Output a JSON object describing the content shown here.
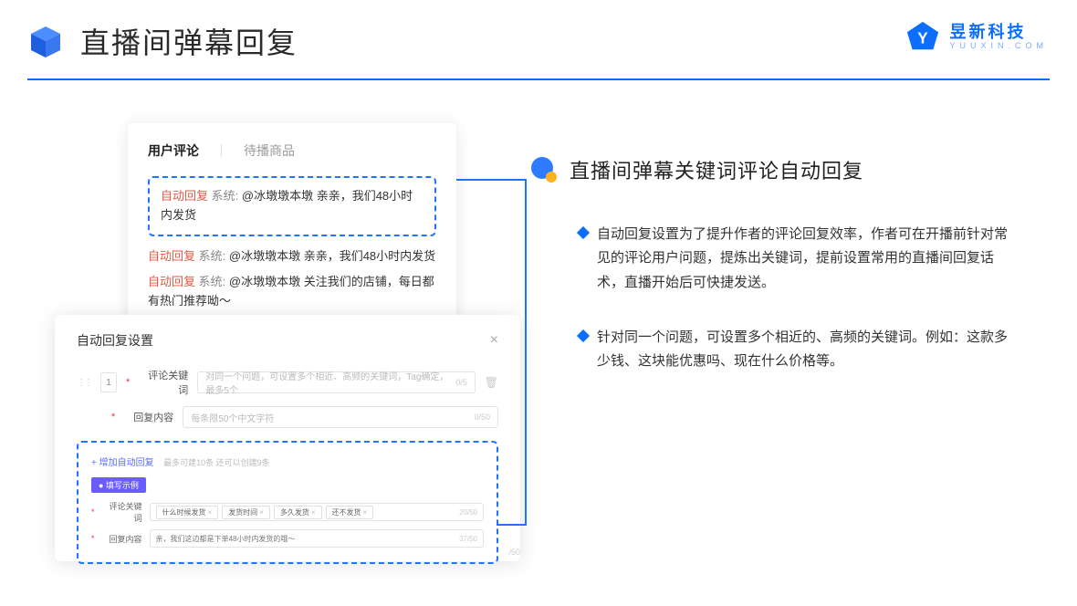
{
  "header": {
    "title": "直播间弹幕回复"
  },
  "brand": {
    "cn": "昱新科技",
    "en": "YUUXIN.COM"
  },
  "comments_card": {
    "tabs": {
      "active": "用户评论",
      "inactive": "待播商品"
    },
    "highlighted": {
      "tag": "自动回复",
      "sys": "系统:",
      "msg": "@冰墩墩本墩 亲亲，我们48小时内发货"
    },
    "rows": [
      {
        "tag": "自动回复",
        "sys": "系统:",
        "msg": "@冰墩墩本墩 亲亲，我们48小时内发货"
      },
      {
        "tag": "自动回复",
        "sys": "系统:",
        "msg": "@冰墩墩本墩 关注我们的店铺，每日都有热门推荐呦～"
      }
    ]
  },
  "settings_card": {
    "title": "自动回复设置",
    "idx": "1",
    "kw": {
      "label": "评论关键词",
      "placeholder": "对同一个问题，可设置多个相近、高频的关键词，Tag确定，最多5个",
      "count": "0/5"
    },
    "reply": {
      "label": "回复内容",
      "placeholder": "每条限50个中文字符",
      "count": "0/50"
    },
    "add": {
      "link": "+ 增加自动回复",
      "note": "最多可建10条 还可以创建9条"
    },
    "example": {
      "badge": "● 填写示例",
      "kw_label": "评论关键词",
      "tags": [
        "什么时候发货",
        "发货时间",
        "多久发货",
        "还不发货"
      ],
      "kw_count": "20/50",
      "reply_label": "回复内容",
      "reply_val": "亲，我们这边都是下单48小时内发货的哦～",
      "reply_count": "37/50",
      "outside_count": "/50"
    }
  },
  "right": {
    "heading": "直播间弹幕关键词评论自动回复",
    "bullets": [
      "自动回复设置为了提升作者的评论回复效率，作者可在开播前针对常见的评论用户问题，提炼出关键词，提前设置常用的直播间回复话术，直播开始后可快捷发送。",
      "针对同一个问题，可设置多个相近的、高频的关键词。例如：这款多少钱、这块能优惠吗、现在什么价格等。"
    ]
  }
}
